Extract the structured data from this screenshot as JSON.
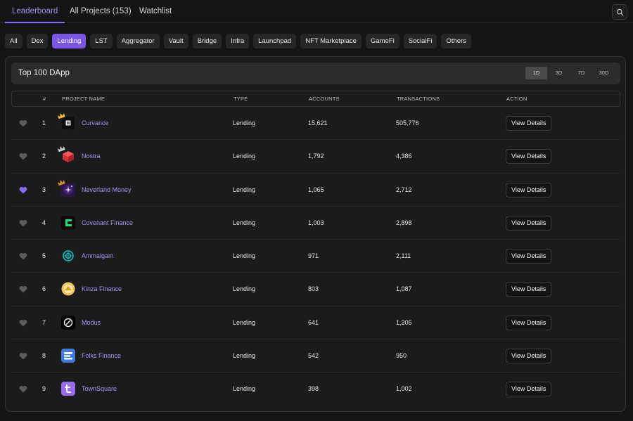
{
  "nav": {
    "tabs": [
      {
        "label": "Leaderboard",
        "active": true
      },
      {
        "label": "All Projects (153)",
        "active": false
      },
      {
        "label": "Watchlist",
        "active": false
      }
    ]
  },
  "categories": [
    {
      "label": "All",
      "active": false
    },
    {
      "label": "Dex",
      "active": false
    },
    {
      "label": "Lending",
      "active": true
    },
    {
      "label": "LST",
      "active": false
    },
    {
      "label": "Aggregator",
      "active": false
    },
    {
      "label": "Vault",
      "active": false
    },
    {
      "label": "Bridge",
      "active": false
    },
    {
      "label": "Infra",
      "active": false
    },
    {
      "label": "Launchpad",
      "active": false
    },
    {
      "label": "NFT Marketplace",
      "active": false
    },
    {
      "label": "GameFi",
      "active": false
    },
    {
      "label": "SocialFi",
      "active": false
    },
    {
      "label": "Others",
      "active": false
    }
  ],
  "panel": {
    "title": "Top 100 DApp",
    "ranges": [
      {
        "label": "1D",
        "active": true
      },
      {
        "label": "3D",
        "active": false
      },
      {
        "label": "7D",
        "active": false
      },
      {
        "label": "30D",
        "active": false
      }
    ]
  },
  "table": {
    "headers": {
      "rank": "#",
      "name": "PROJECT NAME",
      "type": "TYPE",
      "accounts": "ACCOUNTS",
      "transactions": "TRANSACTIONS",
      "action": "ACTION"
    },
    "rows": [
      {
        "rank": "1",
        "name": "Curvance",
        "type": "Lending",
        "accounts": "15,621",
        "transactions": "505,776",
        "action": "View Details",
        "favorited": false,
        "crown": "gold",
        "logo": "curvance-logo"
      },
      {
        "rank": "2",
        "name": "Nostra",
        "type": "Lending",
        "accounts": "1,792",
        "transactions": "4,386",
        "action": "View Details",
        "favorited": false,
        "crown": "silver",
        "logo": "nostra-logo"
      },
      {
        "rank": "3",
        "name": "Neverland Money",
        "type": "Lending",
        "accounts": "1,065",
        "transactions": "2,712",
        "action": "View Details",
        "favorited": true,
        "crown": "bronze",
        "logo": "neverland-logo"
      },
      {
        "rank": "4",
        "name": "Covenant Finance",
        "type": "Lending",
        "accounts": "1,003",
        "transactions": "2,898",
        "action": "View Details",
        "favorited": false,
        "crown": "",
        "logo": "covenant-logo"
      },
      {
        "rank": "5",
        "name": "Ammalgam",
        "type": "Lending",
        "accounts": "971",
        "transactions": "2,111",
        "action": "View Details",
        "favorited": false,
        "crown": "",
        "logo": "ammalgam-logo"
      },
      {
        "rank": "6",
        "name": "Kinza Finance",
        "type": "Lending",
        "accounts": "803",
        "transactions": "1,087",
        "action": "View Details",
        "favorited": false,
        "crown": "",
        "logo": "kinza-logo"
      },
      {
        "rank": "7",
        "name": "Modus",
        "type": "Lending",
        "accounts": "641",
        "transactions": "1,205",
        "action": "View Details",
        "favorited": false,
        "crown": "",
        "logo": "modus-logo"
      },
      {
        "rank": "8",
        "name": "Folks Finance",
        "type": "Lending",
        "accounts": "542",
        "transactions": "950",
        "action": "View Details",
        "favorited": false,
        "crown": "",
        "logo": "folks-logo"
      },
      {
        "rank": "9",
        "name": "TownSquare",
        "type": "Lending",
        "accounts": "398",
        "transactions": "1,002",
        "action": "View Details",
        "favorited": false,
        "crown": "",
        "logo": "townsquare-logo"
      }
    ]
  },
  "colors": {
    "accent": "#7a55e6",
    "link": "#a894f2",
    "background": "#141414",
    "panel": "#1b1b1b",
    "favorite": "#8b6cf0"
  }
}
